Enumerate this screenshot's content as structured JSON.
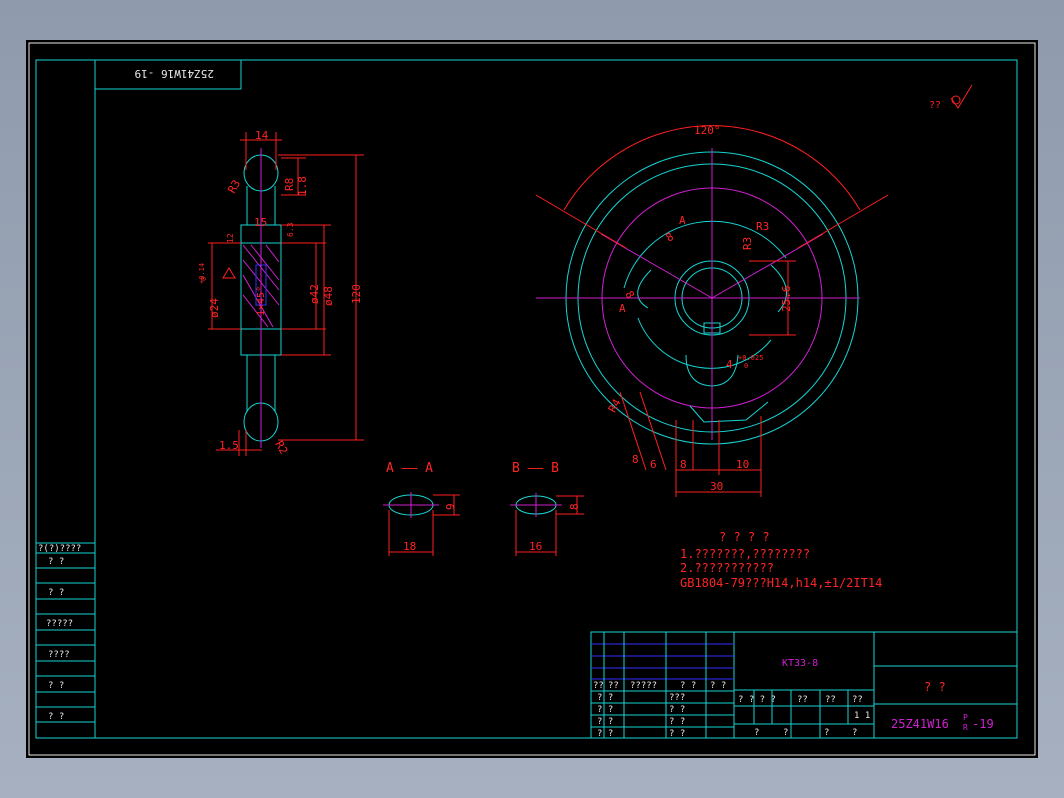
{
  "drawing": {
    "title_code": "KT33-8",
    "part_no_main": "25Z41W16",
    "part_no_sup": "P",
    "part_no_sub": "R",
    "part_no_suffix": "-19",
    "name_cell": "?    ?",
    "mirrored_stamp": "25Z41W16 -19",
    "surface_mark": "??",
    "notes_header": "? ? ? ?",
    "note_1": "1.???????,????????",
    "note_2": "2.???????????",
    "note_3": "GB1804-79???H14,h14,±1/2IT14"
  },
  "side_view": {
    "dims": [
      "14",
      "R3",
      "R8",
      "1.8",
      "6",
      "15",
      "12",
      "6.3",
      "ø24",
      "+0.14",
      "0",
      "1×45°",
      "ø42",
      "ø48",
      "120",
      "1.5",
      "R2",
      "3.2",
      "6.3"
    ]
  },
  "front_view": {
    "dims": [
      "120°",
      "R3",
      "R3",
      "8",
      "8",
      "R4",
      "25.6",
      "+0.025",
      "0",
      "4",
      "8",
      "6",
      "8",
      "10",
      "30",
      "A",
      "A"
    ]
  },
  "sections": [
    {
      "label": "A —— A",
      "width": "18",
      "height": "9"
    },
    {
      "label": "B —— B",
      "width": "16",
      "height": "8"
    }
  ],
  "left_strip": [
    "?(?)????",
    "?    ?",
    "?    ?",
    "?????",
    "????",
    "?    ?",
    "?    ?"
  ],
  "title_block": {
    "header_row": [
      "?? ",
      "??",
      "?????",
      "? ?",
      "? ?"
    ],
    "rows_left": [
      "? ?",
      "? ?",
      "? ?",
      "? ?"
    ],
    "rows_mid": [
      "???",
      "? ?",
      "? ?",
      "? ?"
    ],
    "stage_headers": [
      "? ? ? ?",
      "??",
      "??",
      "??"
    ],
    "scale": "1 1",
    "bottom_row": [
      "?",
      "?",
      "?",
      "?"
    ]
  }
}
